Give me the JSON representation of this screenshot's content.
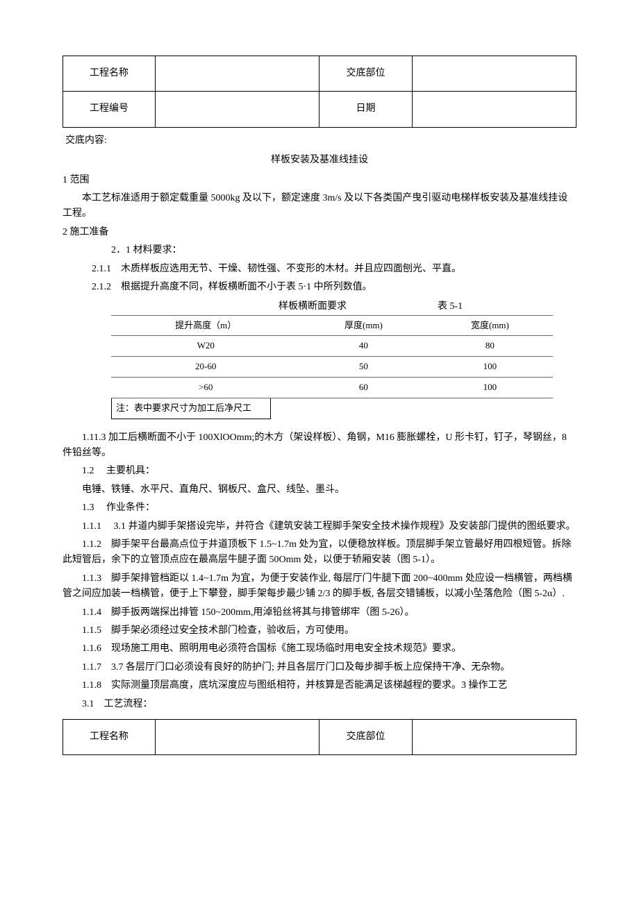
{
  "header": {
    "project_name_label": "工程名称",
    "project_name_value": "",
    "location_label": "交底部位",
    "location_value": "",
    "project_no_label": "工程编号",
    "project_no_value": "",
    "date_label": "日期",
    "date_value": ""
  },
  "content_label": "交底内容:",
  "title": "样板安装及基准线挂设",
  "s1": {
    "heading": "1 范围",
    "p1": "本工艺标准适用于额定载重量 5000kg 及以下，额定速度 3m/s 及以下各类国产曳引驱动电梯样板安装及基准线挂设工程。"
  },
  "s2": {
    "heading": "2 施工准备",
    "it1": "2．1 材料要求：",
    "it2": "2.1.1　木质样板应选用无节、干燥、韧性强、不变形的木材。并且应四面刨光、平直。",
    "it3": "2.1.2　根据提升高度不同，样板横断面不小于表 5·1 中所列数值。"
  },
  "table": {
    "title_left": "样板横断面要求",
    "title_right": "表 5-1",
    "h1": "提升高度（m）",
    "h2": "厚度(mm)",
    "h3": "宽度(mm)",
    "rows": [
      {
        "c1": "W20",
        "c2": "40",
        "c3": "80"
      },
      {
        "c1": "20-60",
        "c2": "50",
        "c3": "100"
      },
      {
        "c1": ">60",
        "c2": "60",
        "c3": "100"
      }
    ],
    "note": "注：表中要求尺寸为加工后净尺工"
  },
  "p113": "1.11.3 加工后横断面不小于 100XlOOmm;的木方（架设样板）、角钢，M16 膨胀螺栓，U 形卡钉，钉子，琴钢丝，8 件铅丝等。",
  "p12": "1.2　 主要机具：",
  "p12b": "电锤、铁锤、水平尺、直角尺、钢板尺、盒尺、线坠、墨斗。",
  "p13": "1.3　 作业条件：",
  "p111": "1.1.1　 3.1 井道内脚手架搭设完毕，并符合《建筑安装工程脚手架安全技术操作规程》及安装部门提供的图纸要求。",
  "p112": "1.1.2　脚手架平台最高点位于井道顶板下 1.5~1.7m 处为宜，以便稳放样板。顶层脚手架立管最好用四根短管。拆除此短管后，余下的立管顶点应在最高层牛腿子面 50Omm 处，以便于轿厢安装（图 5-1）。",
  "p113b": "1.1.3　脚手架排管档距以 1.4~1.7m 为宜，为便于安装作业, 每层厅门牛腿下面 200~400mm 处应设一档横管，两档横管之间应加装一档横管，便于上下攀登，脚手架每步最少铺 2/3 的脚手板, 各层交错铺板，以减小坠落危险（图 5-2α）.",
  "p114": "1.1.4　脚手扳两端探出排管 150~200mm,用淖铅丝将其与排管绑牢（图 5-26）。",
  "p115": "1.1.5　脚手架必须经过安全技术部门检查，验收后，方可使用。",
  "p116": "1.1.6　现场施工用电、照明用电必须符合国标《施工现场临时用电安全技术规范》要求。",
  "p117": "1.1.7　3.7 各层厅门口必须设有良好的防护门; 并且各层厅门口及每步脚手板上应保持干净、无杂物。",
  "p118": "1.1.8　实际测量顶层高度，底坑深度应与图纸相符，并核算是否能满足该梯越程的要求。3 操作工艺",
  "p31": "3.1　工艺流程：",
  "footer": {
    "project_name_label": "工程名称",
    "project_name_value": "",
    "location_label": "交底部位",
    "location_value": ""
  }
}
